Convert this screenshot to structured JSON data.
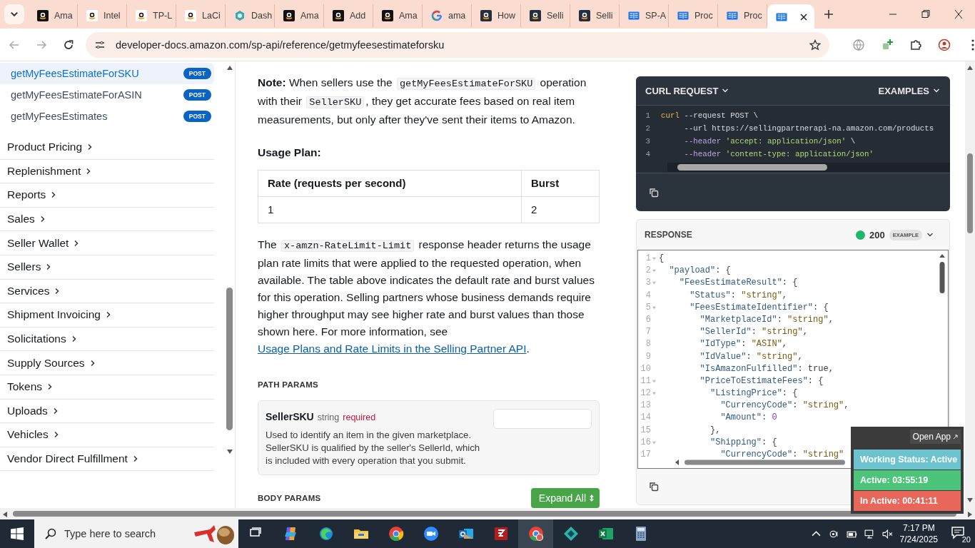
{
  "browser": {
    "tabs": [
      {
        "title": "Ama",
        "kind": "amazon-dark",
        "selected": false
      },
      {
        "title": "Intel",
        "kind": "amazon-light",
        "selected": false
      },
      {
        "title": "TP-L",
        "kind": "amazon-light",
        "selected": false
      },
      {
        "title": "LaCi",
        "kind": "amazon-light",
        "selected": false
      },
      {
        "title": "Dash",
        "kind": "hexagon",
        "selected": false
      },
      {
        "title": "Ama",
        "kind": "amazon-dark",
        "selected": false
      },
      {
        "title": "Add",
        "kind": "amazon-dark",
        "selected": false
      },
      {
        "title": "Ama",
        "kind": "amazon-dark",
        "selected": false
      },
      {
        "title": "ama",
        "kind": "google",
        "selected": false
      },
      {
        "title": "How",
        "kind": "amazon-navy",
        "selected": false
      },
      {
        "title": "Selli",
        "kind": "amazon-navy",
        "selected": false
      },
      {
        "title": "Selli",
        "kind": "amazon-navy",
        "selected": false
      },
      {
        "title": "SP-A",
        "kind": "book",
        "selected": false
      },
      {
        "title": "Proc",
        "kind": "book",
        "selected": false
      },
      {
        "title": "Proc",
        "kind": "book",
        "selected": false
      },
      {
        "kind": "book",
        "selected": true
      }
    ],
    "url": "developer-docs.amazon.com/sp-api/reference/getmyfeesestimateforsku"
  },
  "sidebar": {
    "endpoints": [
      {
        "label": "getMyFeesEstimateForSKU",
        "method": "POST",
        "selected": true
      },
      {
        "label": "getMyFeesEstimateForASIN",
        "method": "POST",
        "selected": false
      },
      {
        "label": "getMyFeesEstimates",
        "method": "POST",
        "selected": false
      }
    ],
    "sections": [
      "Product Pricing",
      "Replenishment",
      "Reports",
      "Sales",
      "Seller Wallet",
      "Sellers",
      "Services",
      "Shipment Invoicing",
      "Solicitations",
      "Supply Sources",
      "Tokens",
      "Uploads",
      "Vehicles",
      "Vendor Direct Fulfillment"
    ]
  },
  "content": {
    "note": [
      {
        "kind": "text",
        "text": "**Note:** When sellers use the "
      },
      {
        "kind": "code",
        "text": "getMyFeesEstimateForSKU"
      },
      {
        "kind": "text",
        "text": " operation with their "
      },
      {
        "kind": "code",
        "text": "SellerSKU"
      },
      {
        "kind": "text",
        "text": ", they get accurate fees based on real item measurements, but only after they've sent their items to Amazon."
      }
    ],
    "usage_heading": "Usage Plan:",
    "usage_table": {
      "columns": [
        "Rate (requests per second)",
        "Burst"
      ],
      "rows": [
        [
          "1",
          "2"
        ]
      ]
    },
    "rate_paragraph": [
      {
        "kind": "text",
        "text": "The "
      },
      {
        "kind": "code",
        "text": "x-amzn-RateLimit-Limit"
      },
      {
        "kind": "text",
        "text": " response header returns the usage plan rate limits that were applied to the requested operation, when available. The table above indicates the default rate and burst values for this operation. Selling partners whose business demands require higher throughput may see higher rate and burst values than those shown here. For more information, see "
      },
      {
        "kind": "link",
        "text": "Usage Plans and Rate Limits in the Selling Partner API"
      },
      {
        "kind": "text",
        "text": "."
      }
    ],
    "path_params": {
      "heading": "PATH PARAMS",
      "params": [
        {
          "name": "SellerSKU",
          "type": "string",
          "required_label": "required",
          "description": "Used to identify an item in the given marketplace. SellerSKU is qualified by the seller's SellerId, which is included with every operation that you submit."
        }
      ]
    },
    "body_params": {
      "heading": "BODY PARAMS",
      "button": "Expand All"
    }
  },
  "request": {
    "title": "CURL REQUEST",
    "examples": "EXAMPLES",
    "lines": [
      {
        "number": "1",
        "parts": [
          {
            "kind": "command",
            "text": "curl"
          },
          {
            "kind": "plain",
            "text": " --request POST \\"
          }
        ]
      },
      {
        "number": "2",
        "parts": [
          {
            "kind": "plain",
            "text": "     --url https://sellingpartnerapi-na.amazon.com/products"
          }
        ]
      },
      {
        "number": "3",
        "parts": [
          {
            "kind": "flag",
            "text": "     --header"
          },
          {
            "kind": "string",
            "text": " 'accept: application/json'"
          },
          {
            "kind": "plain",
            "text": " \\"
          }
        ]
      },
      {
        "number": "4",
        "parts": [
          {
            "kind": "flag",
            "text": "     --header"
          },
          {
            "kind": "string",
            "text": " 'content-type: application/json'"
          }
        ]
      }
    ]
  },
  "response": {
    "title": "RESPONSE",
    "status": "200",
    "badge": "EXAMPLE",
    "lines": [
      {
        "number": "1",
        "fold": true,
        "parts": [
          {
            "kind": "punct",
            "text": "{"
          }
        ]
      },
      {
        "number": "2",
        "fold": true,
        "parts": [
          {
            "kind": "key",
            "text": "  \"payload\""
          },
          {
            "kind": "punct",
            "text": ": {"
          }
        ]
      },
      {
        "number": "3",
        "fold": true,
        "parts": [
          {
            "kind": "key",
            "text": "    \"FeesEstimateResult\""
          },
          {
            "kind": "punct",
            "text": ": {"
          }
        ]
      },
      {
        "number": "4",
        "fold": false,
        "parts": [
          {
            "kind": "key",
            "text": "      \"Status\""
          },
          {
            "kind": "punct",
            "text": ": "
          },
          {
            "kind": "string",
            "text": "\"string\""
          },
          {
            "kind": "punct",
            "text": ","
          }
        ]
      },
      {
        "number": "5",
        "fold": true,
        "parts": [
          {
            "kind": "key",
            "text": "      \"FeesEstimateIdentifier\""
          },
          {
            "kind": "punct",
            "text": ": {"
          }
        ]
      },
      {
        "number": "6",
        "fold": false,
        "parts": [
          {
            "kind": "key",
            "text": "        \"MarketplaceId\""
          },
          {
            "kind": "punct",
            "text": ": "
          },
          {
            "kind": "string",
            "text": "\"string\""
          },
          {
            "kind": "punct",
            "text": ","
          }
        ]
      },
      {
        "number": "7",
        "fold": false,
        "parts": [
          {
            "kind": "key",
            "text": "        \"SellerId\""
          },
          {
            "kind": "punct",
            "text": ": "
          },
          {
            "kind": "string",
            "text": "\"string\""
          },
          {
            "kind": "punct",
            "text": ","
          }
        ]
      },
      {
        "number": "8",
        "fold": false,
        "parts": [
          {
            "kind": "key",
            "text": "        \"IdType\""
          },
          {
            "kind": "punct",
            "text": ": "
          },
          {
            "kind": "string",
            "text": "\"ASIN\""
          },
          {
            "kind": "punct",
            "text": ","
          }
        ]
      },
      {
        "number": "9",
        "fold": false,
        "parts": [
          {
            "kind": "key",
            "text": "        \"IdValue\""
          },
          {
            "kind": "punct",
            "text": ": "
          },
          {
            "kind": "string",
            "text": "\"string\""
          },
          {
            "kind": "punct",
            "text": ","
          }
        ]
      },
      {
        "number": "10",
        "fold": false,
        "parts": [
          {
            "kind": "key",
            "text": "        \"IsAmazonFulfilled\""
          },
          {
            "kind": "punct",
            "text": ": "
          },
          {
            "kind": "literal",
            "text": "true"
          },
          {
            "kind": "punct",
            "text": ","
          }
        ]
      },
      {
        "number": "11",
        "fold": true,
        "parts": [
          {
            "kind": "key",
            "text": "        \"PriceToEstimateFees\""
          },
          {
            "kind": "punct",
            "text": ": {"
          }
        ]
      },
      {
        "number": "12",
        "fold": true,
        "parts": [
          {
            "kind": "key",
            "text": "          \"ListingPrice\""
          },
          {
            "kind": "punct",
            "text": ": {"
          }
        ]
      },
      {
        "number": "13",
        "fold": false,
        "parts": [
          {
            "kind": "key",
            "text": "            \"CurrencyCode\""
          },
          {
            "kind": "punct",
            "text": ": "
          },
          {
            "kind": "string",
            "text": "\"string\""
          },
          {
            "kind": "punct",
            "text": ","
          }
        ]
      },
      {
        "number": "14",
        "fold": false,
        "parts": [
          {
            "kind": "key",
            "text": "            \"Amount\""
          },
          {
            "kind": "punct",
            "text": ": "
          },
          {
            "kind": "number",
            "text": "0"
          }
        ]
      },
      {
        "number": "15",
        "fold": false,
        "parts": [
          {
            "kind": "punct",
            "text": "          },"
          }
        ]
      },
      {
        "number": "16",
        "fold": true,
        "parts": [
          {
            "kind": "key",
            "text": "          \"Shipping\""
          },
          {
            "kind": "punct",
            "text": ": {"
          }
        ]
      },
      {
        "number": "17",
        "fold": false,
        "parts": [
          {
            "kind": "key",
            "text": "            \"CurrencyCode\""
          },
          {
            "kind": "punct",
            "text": ": "
          },
          {
            "kind": "string",
            "text": "\"string\""
          }
        ]
      }
    ]
  },
  "tracker": {
    "open_app": "Open App",
    "bars": [
      {
        "text": "Working Status: Active",
        "color": "#6cc3cd"
      },
      {
        "text": "Active: 03:55:19",
        "color": "#4cc47a"
      },
      {
        "text": "In Active: 00:41:11",
        "color": "#e8675a"
      }
    ]
  },
  "taskbar": {
    "search_placeholder": "Type here to search",
    "apps": [
      {
        "kind": "task-view"
      },
      {
        "kind": "copilot"
      },
      {
        "kind": "edge"
      },
      {
        "kind": "folder"
      },
      {
        "kind": "chrome"
      },
      {
        "kind": "zoom"
      },
      {
        "kind": "outlook"
      },
      {
        "kind": "filezilla"
      },
      {
        "kind": "chrome-profile"
      },
      {
        "kind": "diamond"
      },
      {
        "kind": "excel"
      },
      {
        "kind": "calculator"
      }
    ],
    "time": "7:17 PM",
    "date": "7/24/2025",
    "notifications": "20"
  }
}
